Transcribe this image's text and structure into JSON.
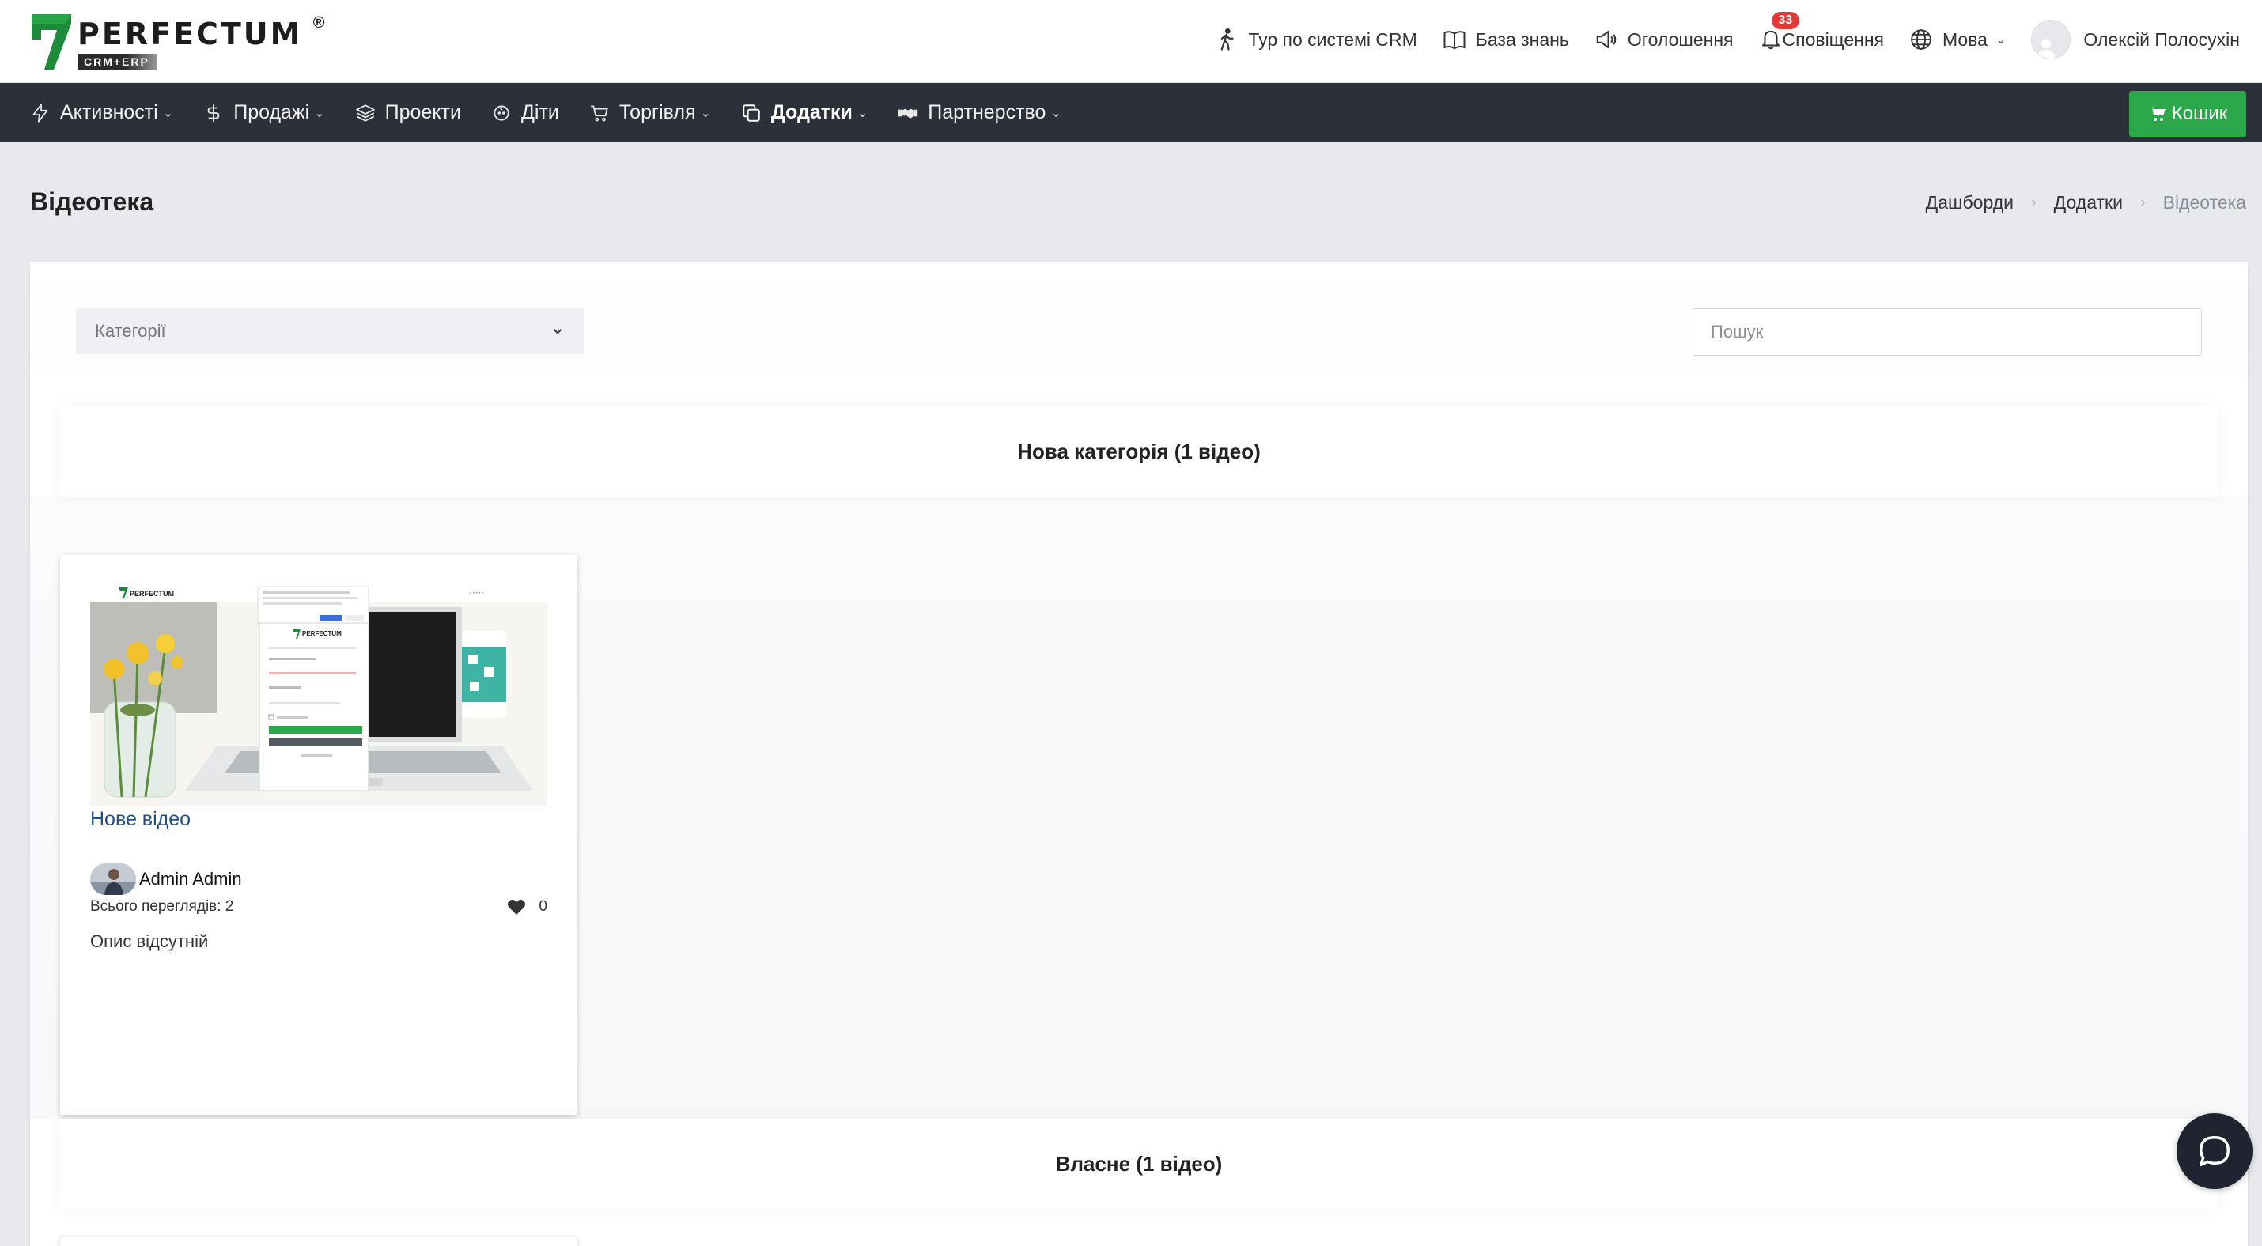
{
  "brand": {
    "name": "PERFECTUM",
    "sub": "CRM+ERP",
    "reg": "®",
    "accent_green": "#2ba84a",
    "logo_green": "#1d8b3a"
  },
  "topnav": {
    "tour": "Тур по системі CRM",
    "knowledge": "База знань",
    "announcements": "Оголошення",
    "notifications": "Сповіщення",
    "notifications_count": "33",
    "language": "Мова",
    "user": "Олексій Полосухін"
  },
  "menu": {
    "activities": "Активності",
    "sales": "Продажі",
    "projects": "Проекти",
    "kids": "Діти",
    "trade": "Торгівля",
    "addons": "Додатки",
    "partnership": "Партнерство",
    "cart": "Кошик"
  },
  "page": {
    "title": "Відеотека",
    "breadcrumb": [
      "Дашборди",
      "Додатки",
      "Відеотека"
    ]
  },
  "filters": {
    "categories_placeholder": "Категорії",
    "search_placeholder": "Пошук"
  },
  "sections": [
    {
      "header": "Нова категорія (1 відео)",
      "videos": [
        {
          "title": "Нове відео",
          "author": "Admin Admin",
          "views_label": "Всього переглядів: 2",
          "likes": "0",
          "description": "Опис відсутній"
        }
      ]
    },
    {
      "header": "Власне (1 відео)"
    }
  ],
  "icons": {
    "tour": "walking-person-icon",
    "knowledge": "book-icon",
    "announcements": "megaphone-icon",
    "notifications": "bell-icon",
    "language": "globe-icon",
    "chat": "chat-bubble-icon"
  }
}
